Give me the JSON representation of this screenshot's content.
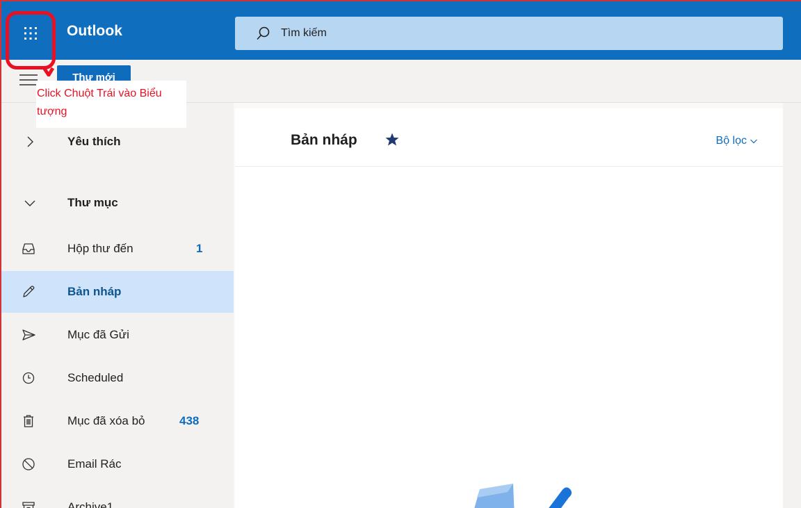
{
  "header": {
    "app_name": "Outlook",
    "search_placeholder": "Tìm kiếm",
    "accent": "#106ebe"
  },
  "commandbar": {
    "new_mail_label": "Thư mới"
  },
  "annotation": {
    "text": "Click Chuột Trái vào Biểu tượng",
    "color": "#e81123"
  },
  "nav": {
    "favorites_label": "Yêu thích",
    "folders_label": "Thư mục",
    "items": [
      {
        "label": "Hộp thư đến",
        "count": "1",
        "icon": "inbox-icon"
      },
      {
        "label": "Bản nháp",
        "count": "",
        "icon": "pencil-icon",
        "selected": true
      },
      {
        "label": "Mục đã Gửi",
        "count": "",
        "icon": "send-icon"
      },
      {
        "label": "Scheduled",
        "count": "",
        "icon": "clock-icon"
      },
      {
        "label": "Mục đã xóa bỏ",
        "count": "438",
        "icon": "trash-icon"
      },
      {
        "label": "Email Rác",
        "count": "",
        "icon": "blocked-icon"
      },
      {
        "label": "Archive1",
        "count": "",
        "icon": "archive-icon"
      }
    ]
  },
  "list": {
    "title": "Bản nháp",
    "filter_label": "Bộ lọc"
  }
}
